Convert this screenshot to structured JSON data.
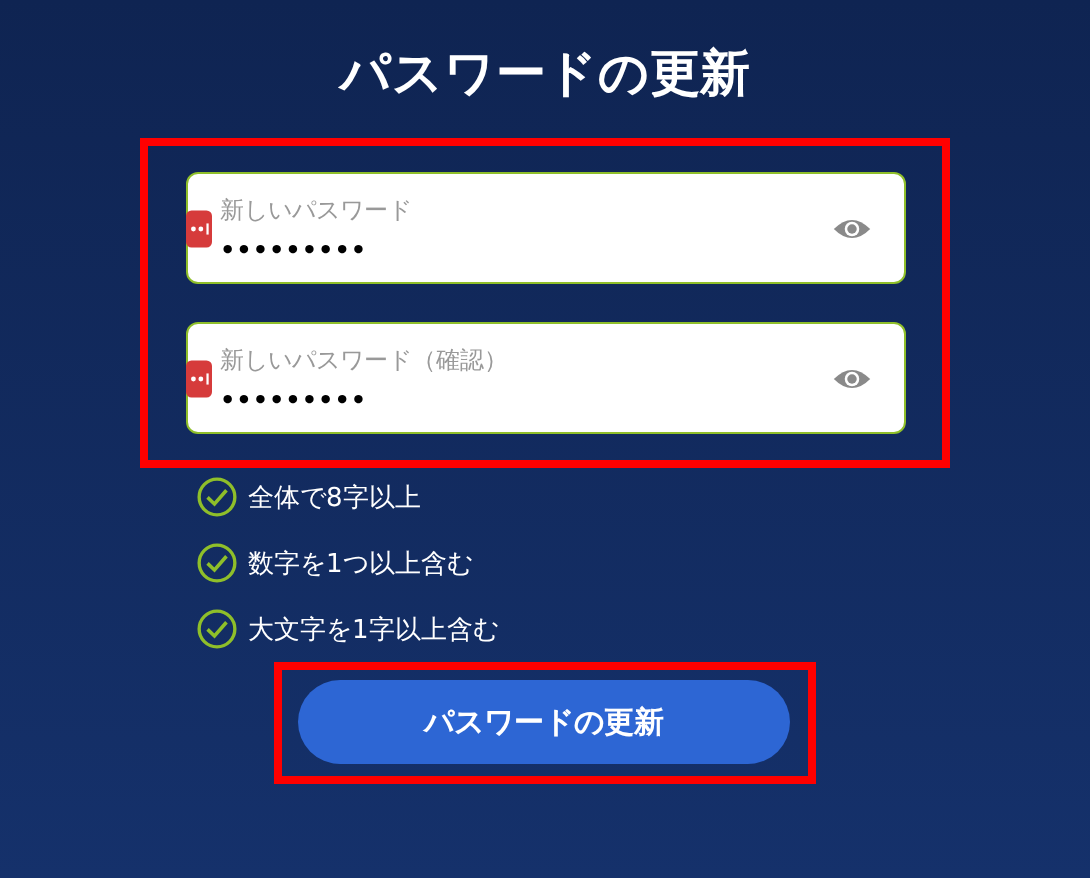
{
  "title": "パスワードの更新",
  "form": {
    "highlighted": true,
    "fields": [
      {
        "label": "新しいパスワード",
        "value": "•••••••••"
      },
      {
        "label": "新しいパスワード（確認）",
        "value": "•••••••••"
      }
    ]
  },
  "rules": [
    {
      "text": "全体で8字以上",
      "checked": true
    },
    {
      "text": "数字を1つ以上含む",
      "checked": true
    },
    {
      "text": "大文字を1字以上含む",
      "checked": true
    }
  ],
  "submit": {
    "label": "パスワードの更新",
    "highlighted": true
  }
}
